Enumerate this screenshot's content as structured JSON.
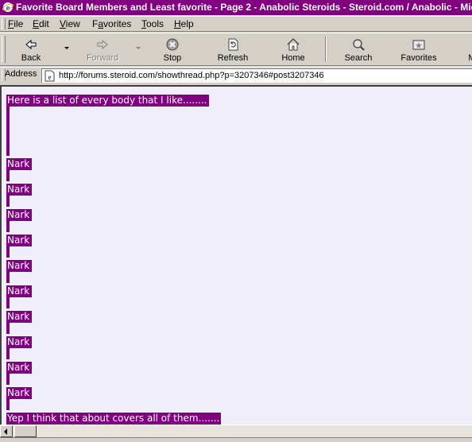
{
  "window": {
    "title": "Favorite Board Members and Least favorite - Page 2 - Anabolic Steroids - Steroid.com / Anabolic - Microsoft Internet Explorer"
  },
  "menu": {
    "items": [
      {
        "label": "File",
        "key": "F",
        "rest": "ile"
      },
      {
        "label": "Edit",
        "key": "E",
        "rest": "dit"
      },
      {
        "label": "View",
        "key": "V",
        "rest": "iew"
      },
      {
        "label": "Favorites",
        "key": "a",
        "pre": "F",
        "rest": "vorites"
      },
      {
        "label": "Tools",
        "key": "T",
        "rest": "ools"
      },
      {
        "label": "Help",
        "key": "H",
        "rest": "elp"
      }
    ]
  },
  "toolbar": {
    "back": "Back",
    "forward": "Forward",
    "stop": "Stop",
    "refresh": "Refresh",
    "home": "Home",
    "search": "Search",
    "favorites": "Favorites",
    "more": "M"
  },
  "address": {
    "label": "Address",
    "url": "http://forums.steroid.com/showthread.php?p=3207346#post3207346"
  },
  "post": {
    "intro": "Here is a list of every body that I like........",
    "names": [
      "Nark",
      "Nark",
      "Nark",
      "Nark",
      "Nark",
      "Nark",
      "Nark",
      "Nark",
      "Nark",
      "Nark"
    ],
    "outro": "Yep I think that about covers all of them......."
  },
  "colors": {
    "titlebar": "#800080",
    "selection": "#800080",
    "page_background": "#f0eefa",
    "chrome": "#d4d0c8"
  },
  "icons": {
    "title": "ie-logo-icon",
    "back": "back-arrow-icon",
    "forward": "forward-arrow-icon",
    "stop": "stop-icon",
    "refresh": "refresh-icon",
    "home": "home-icon",
    "search": "search-icon",
    "favorites": "favorites-icon",
    "page": "ie-page-icon"
  }
}
